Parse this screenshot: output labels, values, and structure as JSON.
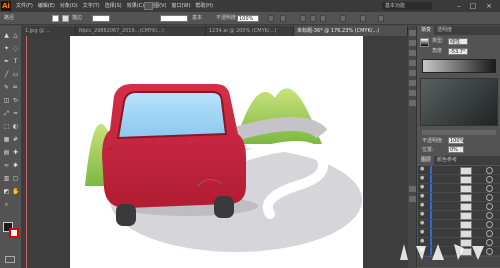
{
  "app": {
    "logo": "Ai"
  },
  "menu": {
    "items": [
      "文件(F)",
      "编辑(E)",
      "对象(O)",
      "文字(T)",
      "选择(S)",
      "效果(C)",
      "视图(V)",
      "窗口(W)",
      "帮助(H)"
    ]
  },
  "workspace": {
    "label": "基本功能"
  },
  "control": {
    "selection_label": "路径",
    "stroke_label": "描边",
    "style_label": "基本",
    "opacity_label": "不透明度",
    "opacity_value": "100%"
  },
  "tabs": [
    {
      "label": "1.jpg @ ...",
      "active": false
    },
    {
      "label": "Nipic_29862067_2019...(CMYK/...)",
      "active": false
    },
    {
      "label": "1234.ai @ 200% (CMYK/...)",
      "active": false
    },
    {
      "label": "未标题-36* @ 176.23% (CMYK/...)",
      "active": true
    }
  ],
  "toolbox": {
    "tools": [
      "selection-tool",
      "direct-selection-tool",
      "magic-wand-tool",
      "lasso-tool",
      "pen-tool",
      "type-tool",
      "line-tool",
      "rectangle-tool",
      "paintbrush-tool",
      "pencil-tool",
      "eraser-tool",
      "rotate-tool",
      "scale-tool",
      "width-tool",
      "free-transform-tool",
      "shape-builder-tool",
      "perspective-tool",
      "mesh-tool",
      "gradient-tool",
      "eyedropper-tool",
      "blend-tool",
      "symbol-sprayer-tool",
      "graph-tool",
      "artboard-tool",
      "slice-tool",
      "hand-tool",
      "zoom-tool"
    ]
  },
  "gradient_panel": {
    "tabs": [
      "渐变",
      "透明度"
    ],
    "type_label": "类型:",
    "type_value": "线性",
    "angle_label": "角度",
    "angle_value": "-53.7°",
    "opacity_label": "不透明度:",
    "opacity_value": "100%",
    "location_label": "位置:",
    "location_value": "0%"
  },
  "layers_panel": {
    "tabs": [
      "图层",
      "颜色参考"
    ],
    "row_count": 11
  },
  "colors": {
    "car_red": "#c8243b",
    "window_blue": "#9fd4f5",
    "road_gray": "#d2d2d6",
    "hill_green": "#8cc63f",
    "accent_selection": "#2d6ae0"
  }
}
